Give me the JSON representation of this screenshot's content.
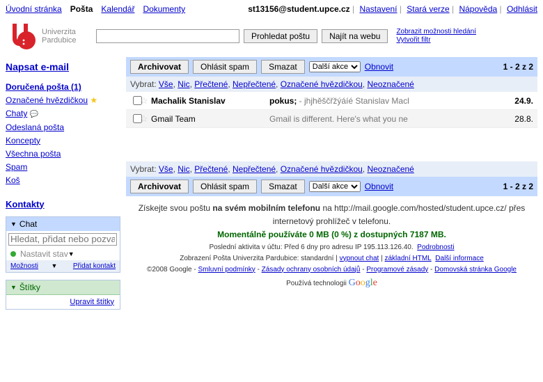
{
  "topnav": {
    "home": "Úvodní stránka",
    "mail": "Pošta",
    "calendar": "Kalendář",
    "docs": "Dokumenty",
    "email": "st13156@student.upce.cz",
    "settings": "Nastavení",
    "old": "Stará verze",
    "help": "Nápověda",
    "logout": "Odhlásit"
  },
  "logo": {
    "line1": "Univerzita",
    "line2": "Pardubice"
  },
  "search": {
    "value": "",
    "btn_mail": "Prohledat poštu",
    "btn_web": "Najít na webu",
    "link_opts": "Zobrazit možnosti hledání",
    "link_filter": "Vytvořit filtr"
  },
  "side": {
    "compose": "Napsat e-mail",
    "inbox": "Doručená pošta (1)",
    "starred": "Označené hvězdičkou",
    "chats": "Chaty",
    "sent": "Odeslaná pošta",
    "drafts": "Koncepty",
    "all": "Všechna pošta",
    "spam": "Spam",
    "trash": "Koš",
    "contacts": "Kontakty"
  },
  "chat": {
    "title": "Chat",
    "placeholder": "Hledat, přidat nebo pozvat",
    "status": "Nastavit stav",
    "options": "Možnosti",
    "add": "Přidat kontakt"
  },
  "labels": {
    "title": "Štítky",
    "edit": "Upravit štítky"
  },
  "toolbar": {
    "archive": "Archivovat",
    "spam": "Ohlásit spam",
    "delete": "Smazat",
    "more": "Další akce",
    "refresh": "Obnovit",
    "range": "1 - 2 z 2"
  },
  "seltext": {
    "prefix": "Vybrat:",
    "all": "Vše",
    "none": "Nic",
    "read": "Přečtené",
    "unread": "Nepřečtené",
    "starred": "Označené hvězdičkou",
    "unstarred": "Neoznačené"
  },
  "messages": [
    {
      "from": "Machalik Stanislav",
      "subj": "pokus;",
      "snip": " - jhjhěščřžýáíé Stanislav Macl",
      "date": "24.9.",
      "unread": true
    },
    {
      "from": "Gmail Team",
      "subj": "",
      "snip": "Gmail is different. Here's what you ne",
      "date": "28.8.",
      "unread": false
    }
  ],
  "footer": {
    "mobile1": "Získejte svou poštu ",
    "mobile_b": "na svém mobilním telefonu",
    "mobile2": " na http://mail.google.com/hosted/student.upce.cz/ přes internetový prohlížeč v telefonu.",
    "quota": "Momentálně používáte 0 MB (0 %) z dostupných 7187 MB.",
    "activity": "Poslední aktivita v účtu: Před 6 dny pro adresu IP 195.113.126.40.",
    "details": "Podrobnosti",
    "view_prefix": "Zobrazení Pošta Univerzita Pardubice: standardní | ",
    "chat_off": "vypnout chat",
    "basic": "základní HTML",
    "more_info": "Další informace",
    "copy": "©2008 Google - ",
    "terms": "Smluvní podmínky",
    "privacy": "Zásady ochrany osobních údajů",
    "program": "Programové zásady",
    "goog_home": "Domovská stránka Google",
    "powered": "Používá technologii "
  }
}
